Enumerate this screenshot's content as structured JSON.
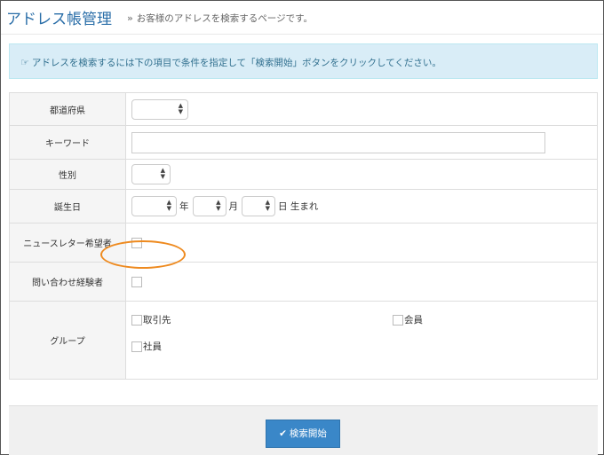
{
  "header": {
    "title": "アドレス帳管理",
    "breadcrumb_chevron": "»",
    "subtitle": "お客様のアドレスを検索するページです。"
  },
  "alert": {
    "icon": "hand-point-right-icon",
    "text": "アドレスを検索するには下の項目で条件を指定して「検索開始」ボタンをクリックしてください。"
  },
  "form": {
    "prefecture": {
      "label": "都道府県",
      "value": ""
    },
    "keyword": {
      "label": "キーワード",
      "value": "",
      "placeholder": ""
    },
    "gender": {
      "label": "性別",
      "value": ""
    },
    "birthday": {
      "label": "誕生日",
      "year_value": "",
      "year_unit": "年",
      "month_value": "",
      "month_unit": "月",
      "day_value": "",
      "day_unit": "日 生まれ"
    },
    "newsletter": {
      "label": "ニュースレター希望者",
      "checked": false
    },
    "inquiry": {
      "label": "問い合わせ経験者",
      "checked": false
    },
    "group": {
      "label": "グループ",
      "options": [
        {
          "label": "取引先",
          "checked": false
        },
        {
          "label": "会員",
          "checked": false
        },
        {
          "label": "社員",
          "checked": false
        }
      ]
    }
  },
  "actions": {
    "search_label": "検索開始"
  },
  "colors": {
    "title": "#2a6ea8",
    "alert_bg": "#d9edf7",
    "alert_text": "#31708f",
    "button_bg": "#3a87c8",
    "highlight": "#ee8a1f"
  }
}
